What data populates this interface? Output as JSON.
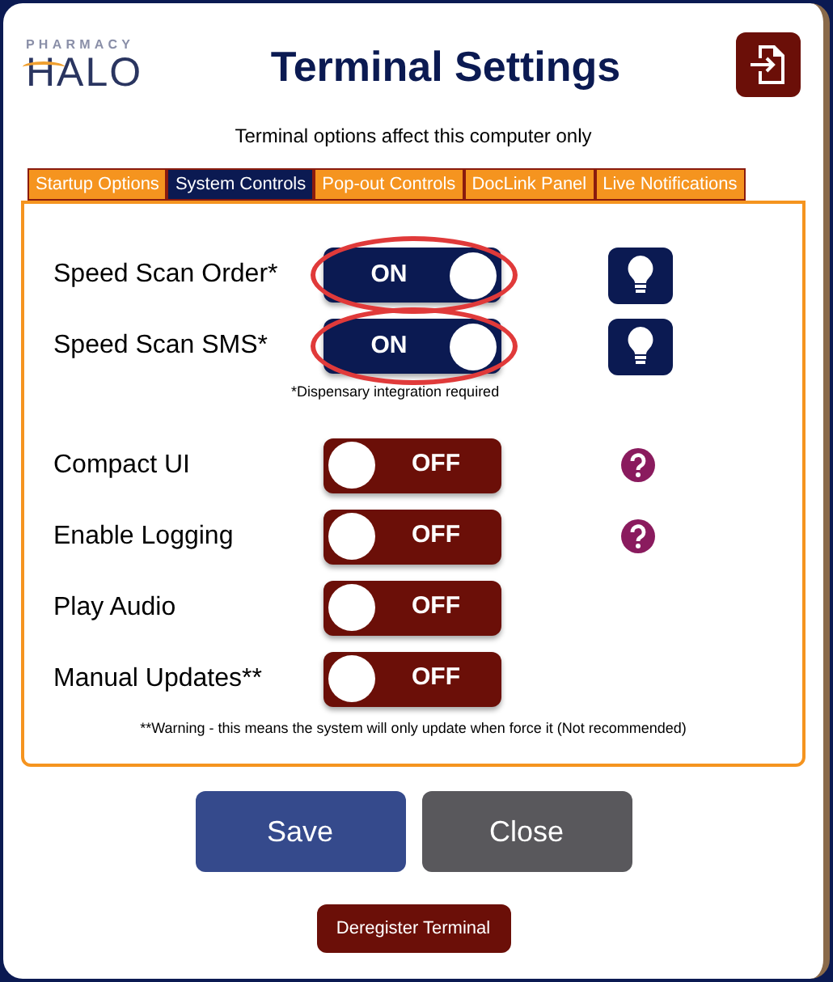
{
  "logo": {
    "top": "PHARMACY",
    "main": "HALO"
  },
  "window": {
    "title": "Terminal Settings",
    "subtitle": "Terminal options affect this computer only"
  },
  "tabs": [
    {
      "label": "Startup Options",
      "selected": false
    },
    {
      "label": "System Controls",
      "selected": true
    },
    {
      "label": "Pop-out Controls",
      "selected": false
    },
    {
      "label": "DocLink Panel",
      "selected": false
    },
    {
      "label": "Live Notifications",
      "selected": false
    }
  ],
  "settings": [
    {
      "label": "Speed Scan Order*",
      "on": true,
      "state_text": "ON",
      "highlighted": true,
      "kind": "bulb"
    },
    {
      "label": "Speed Scan SMS*",
      "on": true,
      "state_text": "ON",
      "highlighted": true,
      "kind": "bulb",
      "note": "*Dispensary integration required"
    },
    {
      "label": "Compact UI",
      "on": false,
      "state_text": "OFF",
      "highlighted": false,
      "kind": "question"
    },
    {
      "label": "Enable Logging",
      "on": false,
      "state_text": "OFF",
      "highlighted": false,
      "kind": "question"
    },
    {
      "label": "Play Audio",
      "on": false,
      "state_text": "OFF",
      "highlighted": false,
      "kind": "plain"
    },
    {
      "label": "Manual Updates**",
      "on": false,
      "state_text": "OFF",
      "highlighted": false,
      "kind": "plain",
      "note": "**Warning - this means the system will only update when force it (Not recommended)"
    }
  ],
  "buttons": [
    {
      "label": "Save",
      "kind": "primary"
    },
    {
      "label": "Close",
      "kind": "secondary"
    }
  ],
  "deregister_button": "Deregister Terminal"
}
